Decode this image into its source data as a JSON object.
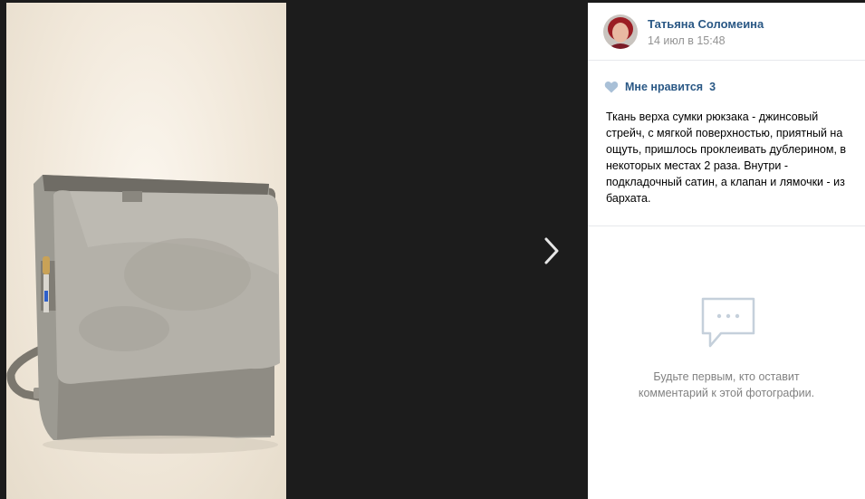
{
  "post": {
    "author_name": "Татьяна Соломеина",
    "date": "14 июл в 15:48",
    "likes_label": "Мне нравится",
    "likes_count": "3",
    "description": "Ткань верха сумки рюкзака - джинсовый стрейч, с мягкой поверхностью, приятный на ощуть, пришлось проклеивать дублерином, в некоторых местах 2 раза. Внутри - подкладочный сатин, а клапан и лямочки - из бархата."
  },
  "comments": {
    "empty_line1": "Будьте первым, кто оставит",
    "empty_line2": "комментарий к этой фотографии."
  },
  "icons": {
    "next": "chevron-right-icon",
    "like": "heart-icon",
    "comments_empty": "chat-bubble-icon"
  },
  "colors": {
    "link": "#2a5885",
    "muted": "#939393",
    "heart": "#a9c0d7"
  }
}
